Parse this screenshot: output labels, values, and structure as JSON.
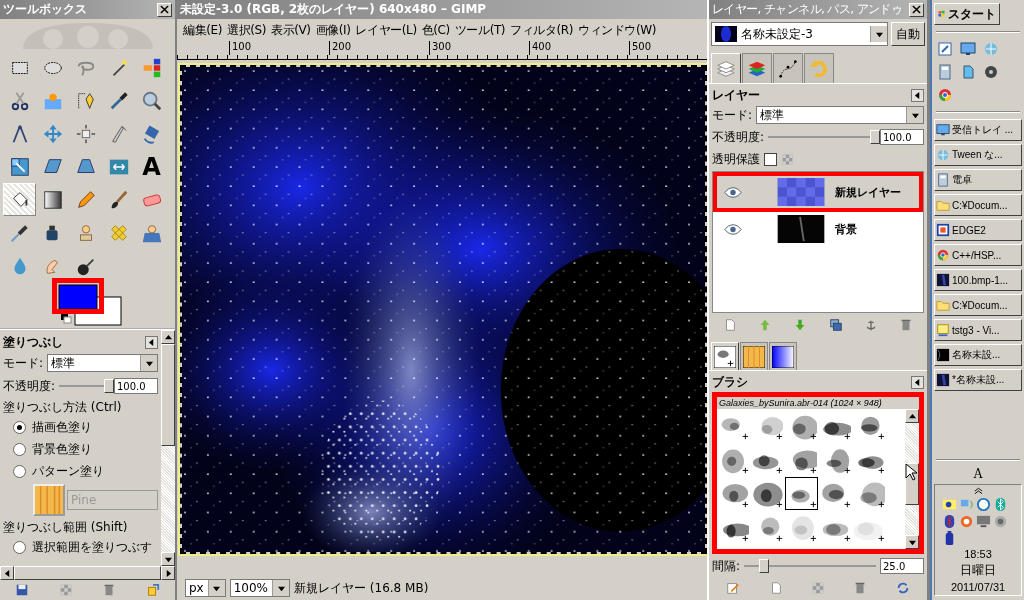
{
  "toolbox": {
    "title": "ツールボックス",
    "tools": [
      {
        "selected": false
      },
      {
        "selected": false
      },
      {
        "selected": false
      },
      {
        "selected": false
      },
      {
        "selected": false
      },
      {
        "selected": false
      },
      {
        "selected": false
      },
      {
        "selected": false
      },
      {
        "selected": false
      },
      {
        "selected": false
      },
      {
        "selected": false
      },
      {
        "selected": false
      },
      {
        "selected": false
      },
      {
        "selected": false
      },
      {
        "selected": false
      },
      {
        "selected": false
      },
      {
        "selected": false
      },
      {
        "selected": false
      },
      {
        "selected": false
      },
      {
        "selected": false,
        "glyph": "A"
      },
      {
        "selected": true
      },
      {
        "selected": false
      },
      {
        "selected": false
      },
      {
        "selected": false
      },
      {
        "selected": false
      },
      {
        "selected": false
      },
      {
        "selected": false
      },
      {
        "selected": false
      },
      {
        "selected": false
      },
      {
        "selected": false
      },
      {
        "selected": false
      },
      {
        "selected": false
      },
      {
        "selected": false
      }
    ],
    "colors_highlighted": true
  },
  "tool_options": {
    "title": "塗りつぶし",
    "mode_label": "モード:",
    "mode": "標準",
    "opacity_label": "不透明度:",
    "opacity": {
      "level": 1.0,
      "reading": "100.0"
    },
    "fill_type_label": "塗りつぶし方法 (Ctrl)",
    "fill_types": [
      {
        "label": "描画色塗り",
        "selected": true
      },
      {
        "label": "背景色塗り",
        "selected": false
      },
      {
        "label": "パターン塗り",
        "selected": false
      }
    ],
    "pattern": "Pine",
    "fill_area_label": "塗りつぶし範囲 (Shift)",
    "fill_areas": [
      {
        "label": "選択範囲を塗りつぶす",
        "selected": false
      }
    ]
  },
  "image_window": {
    "title": "未設定-3.0 (RGB, 2枚のレイヤー) 640x480 – GIMP",
    "menu": [
      "編集(E)",
      "選択(S)",
      "表示(V)",
      "画像(I)",
      "レイヤー(L)",
      "色(C)",
      "ツール(T)",
      "フィルタ(R)",
      "ウィンドウ(W)"
    ],
    "ruler_ticks": [
      "100",
      "200",
      "300",
      "400",
      "500"
    ],
    "unit": "px",
    "zoom": "100%",
    "status": "新規レイヤー (16.8 MB)"
  },
  "dock": {
    "title": "レイヤー, チャンネル, パス, アンドゥ",
    "image": "名称未設定-3",
    "auto_button": "自動",
    "tabs": [
      {
        "selected": true
      },
      {
        "selected": false
      },
      {
        "selected": false
      },
      {
        "selected": false
      }
    ],
    "layers_title": "レイヤー",
    "mode_label": "モード:",
    "mode": "標準",
    "opacity_label": "不透明度:",
    "opacity": {
      "level": 1.0,
      "reading": "100.0"
    },
    "lock_label": "透明保護",
    "lock_alpha": false,
    "layers": [
      {
        "name": "新規レイヤー",
        "visible": true,
        "selected": true,
        "highlighted": true,
        "kind": "transparent"
      },
      {
        "name": "背景",
        "visible": true,
        "selected": false,
        "highlighted": false,
        "kind": "dark"
      }
    ],
    "brush_tabs": [
      {
        "selected": true
      },
      {
        "selected": false
      },
      {
        "selected": false
      }
    ],
    "brushes_title": "ブラシ",
    "brush_name": "Galaxies_bySunira.abr-014 (1024 × 948)",
    "brushes_highlighted": true,
    "brushes": [
      {
        "selected": false
      },
      {
        "selected": false
      },
      {
        "selected": false
      },
      {
        "selected": false
      },
      {
        "selected": false
      },
      {
        "selected": false
      },
      {
        "selected": false
      },
      {
        "selected": false
      },
      {
        "selected": false
      },
      {
        "selected": false
      },
      {
        "selected": false
      },
      {
        "selected": false
      },
      {
        "selected": true
      },
      {
        "selected": false
      },
      {
        "selected": false
      },
      {
        "selected": false
      },
      {
        "selected": false
      },
      {
        "selected": false
      },
      {
        "selected": false
      },
      {
        "selected": false
      }
    ],
    "spacing_label": "間隔:",
    "spacing": {
      "level": 0.16,
      "reading": "25.0"
    }
  },
  "taskbar": {
    "start": "スタート",
    "tasks": [
      {
        "label": "受信トレイ ..."
      },
      {
        "label": "Tween な..."
      },
      {
        "label": "電卓"
      },
      {
        "label": "C:¥Docum..."
      },
      {
        "label": "EDGE2"
      },
      {
        "label": "C++/HSP..."
      },
      {
        "label": "100.bmp-1..."
      },
      {
        "label": "C:¥Docum..."
      },
      {
        "label": "tstg3 - Vi..."
      },
      {
        "label": "名称未設..."
      },
      {
        "label": "*名称未設..."
      }
    ],
    "language": "A",
    "clock": {
      "time": "18:53",
      "day": "日曜日",
      "date": "2011/07/31"
    }
  }
}
